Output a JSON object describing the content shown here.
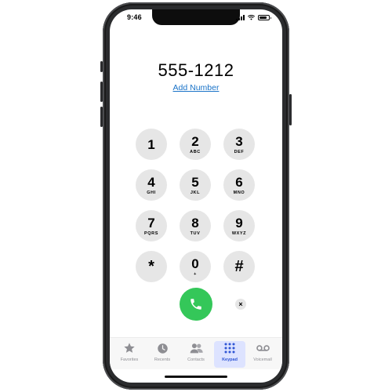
{
  "status_bar": {
    "time": "9:46"
  },
  "dialer": {
    "number": "555-1212",
    "add_number_label": "Add Number"
  },
  "keypad": [
    {
      "digit": "1",
      "letters": ""
    },
    {
      "digit": "2",
      "letters": "ABC"
    },
    {
      "digit": "3",
      "letters": "DEF"
    },
    {
      "digit": "4",
      "letters": "GHI"
    },
    {
      "digit": "5",
      "letters": "JKL"
    },
    {
      "digit": "6",
      "letters": "MNO"
    },
    {
      "digit": "7",
      "letters": "PQRS"
    },
    {
      "digit": "8",
      "letters": "TUV"
    },
    {
      "digit": "9",
      "letters": "WXYZ"
    },
    {
      "digit": "*",
      "letters": ""
    },
    {
      "digit": "0",
      "letters": "+"
    },
    {
      "digit": "#",
      "letters": ""
    }
  ],
  "actions": {
    "call_icon": "phone-icon",
    "delete_glyph": "×"
  },
  "tabs": [
    {
      "label": "Favorites",
      "icon": "star-icon",
      "active": false
    },
    {
      "label": "Recents",
      "icon": "clock-icon",
      "active": false
    },
    {
      "label": "Contacts",
      "icon": "people-icon",
      "active": false
    },
    {
      "label": "Keypad",
      "icon": "keypad-icon",
      "active": true
    },
    {
      "label": "Voicemail",
      "icon": "voicemail-icon",
      "active": false
    }
  ],
  "colors": {
    "call_green": "#34c759",
    "link_blue": "#1a73c8",
    "key_gray": "#e6e6e6",
    "active_tab": "#2f55d4"
  }
}
